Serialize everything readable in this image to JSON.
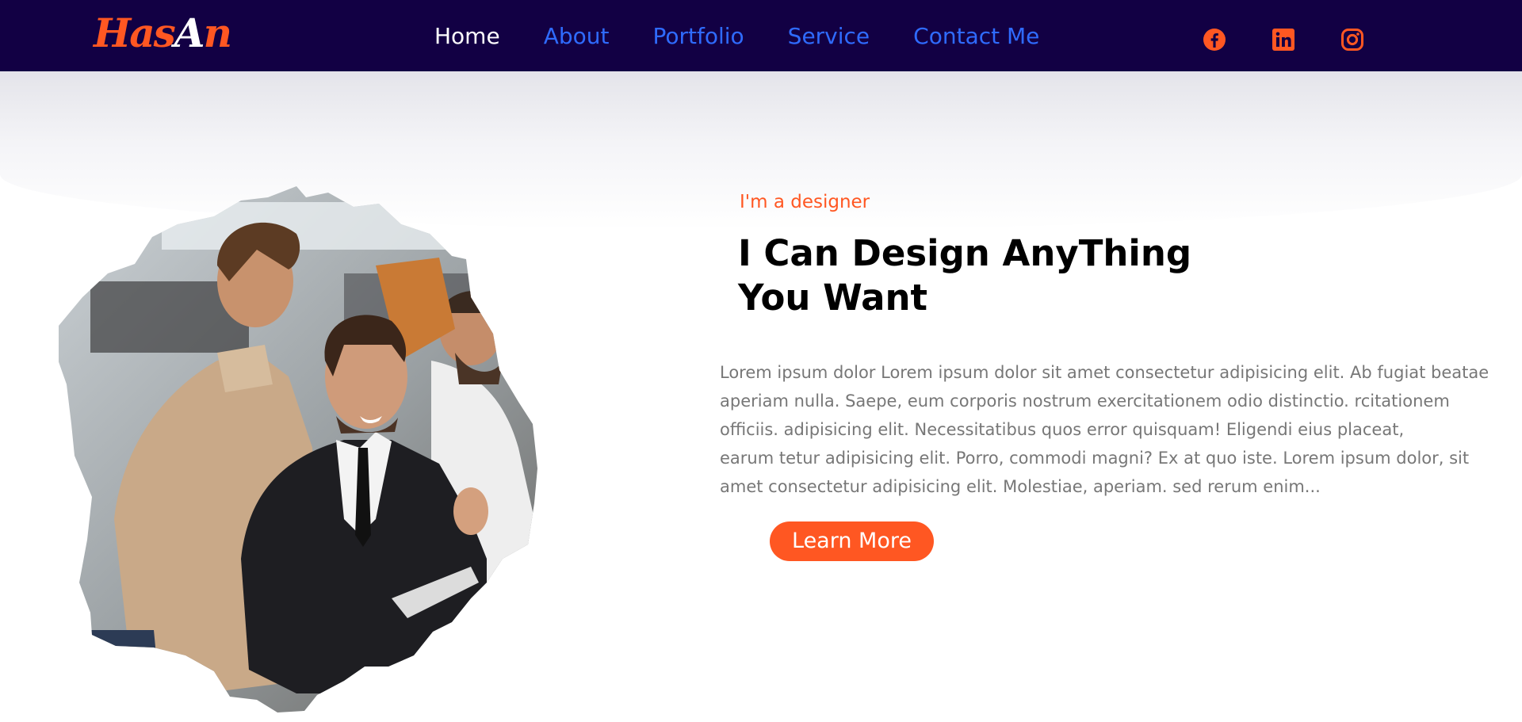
{
  "logo": {
    "part1": "Has",
    "part2": "A",
    "part3": "n"
  },
  "nav": {
    "items": [
      {
        "label": "Home",
        "active": true
      },
      {
        "label": "About"
      },
      {
        "label": "Portfolio"
      },
      {
        "label": "Service"
      },
      {
        "label": "Contact Me"
      }
    ],
    "social": [
      "facebook-icon",
      "linkedin-icon",
      "instagram-icon"
    ]
  },
  "hero": {
    "subtitle": "I'm a designer",
    "headline": [
      "I Can Design AnyThing",
      "You Want"
    ],
    "body_lines": [
      "Lorem ipsum dolor Lorem ipsum dolor sit amet consectetur adipisicing elit. Ab fugiat beatae",
      "aperiam nulla. Saepe, eum corporis nostrum exercitationem odio distinctio. rcitationem",
      "officiis. adipisicing elit. Necessitatibus quos error quisquam! Eligendi eius placeat,",
      "earum tetur adipisicing elit. Porro, commodi magni? Ex at quo iste. Lorem ipsum dolor, sit",
      "amet consectetur adipisicing elit. Molestiae, aperiam. sed rerum enim..."
    ],
    "button_label": "Learn More"
  },
  "colors": {
    "nav_bg": "#120044",
    "accent": "#ff5722",
    "link": "#2f6bff",
    "body_text": "#777777"
  }
}
